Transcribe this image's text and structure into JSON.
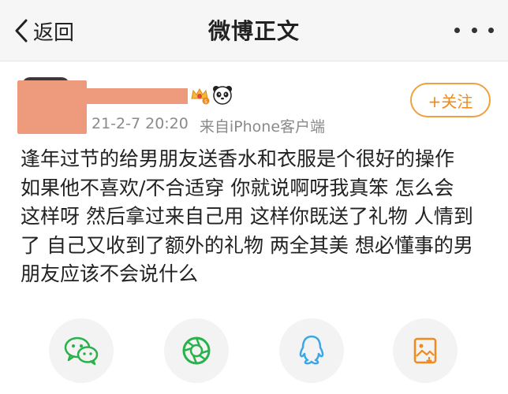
{
  "navbar": {
    "back_label": "返回",
    "title": "微博正文"
  },
  "post": {
    "timestamp": "21-2-7 20:20",
    "source": "来自iPhone客户端",
    "follow_label": "+关注",
    "body": "逢年过节的给男朋友送香水和衣服是个很好的操作\n如果他不喜欢/不合适穿 你就说啊呀我真笨 怎么会\n这样呀 然后拿过来自己用 这样你既送了礼物 人情到\n了 自己又收到了额外的礼物 两全其美 想必懂事的男\n朋友应该不会说什么"
  },
  "share": {
    "icons": [
      "wechat-icon",
      "moments-icon",
      "qq-icon",
      "save-image-icon"
    ]
  },
  "colors": {
    "accent": "#f08a1c",
    "wechat_green": "#27b24a",
    "qq_blue": "#3aa7e8",
    "redacted": "#ee9a7c"
  }
}
